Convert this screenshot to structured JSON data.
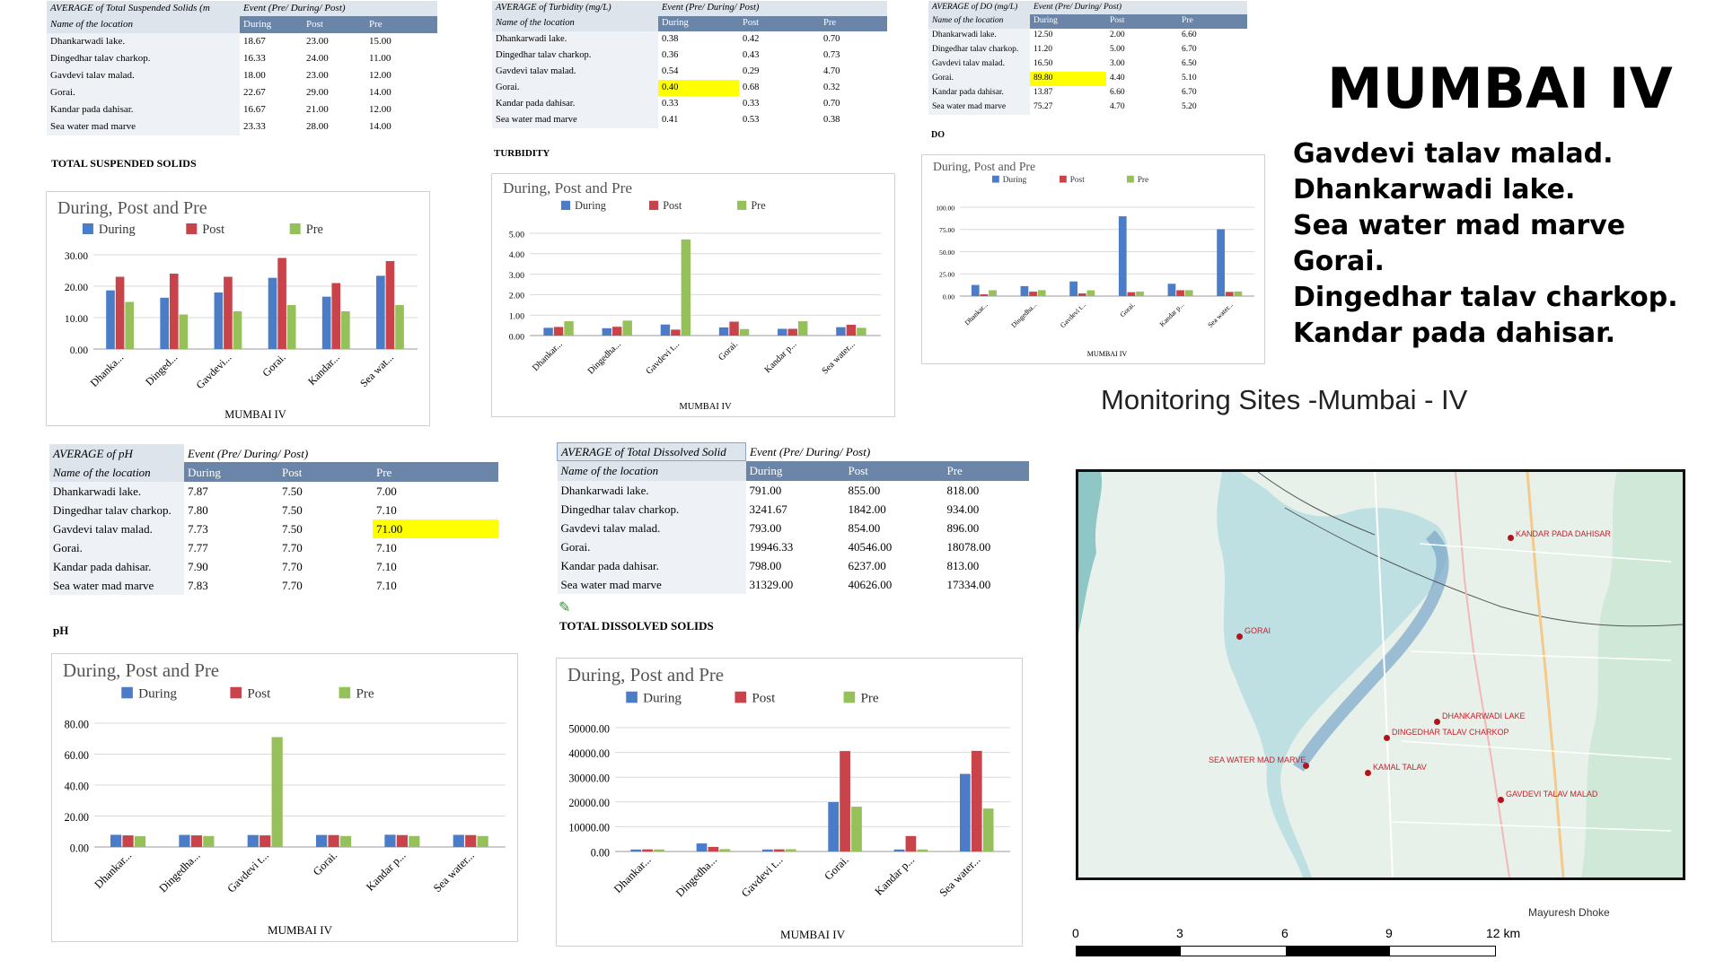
{
  "tables": {
    "tss": {
      "title": "AVERAGE of Total Suspended Solids (m",
      "event": "Event (Pre/ During/ Post)",
      "col_name": "Name of the location",
      "cols": [
        "During",
        "Post",
        "Pre"
      ],
      "rows": [
        {
          "name": "Dhankarwadi lake.",
          "vals": [
            "18.67",
            "23.00",
            "15.00"
          ]
        },
        {
          "name": "Dingedhar talav charkop.",
          "vals": [
            "16.33",
            "24.00",
            "11.00"
          ]
        },
        {
          "name": "Gavdevi talav malad.",
          "vals": [
            "18.00",
            "23.00",
            "12.00"
          ]
        },
        {
          "name": "Gorai.",
          "vals": [
            "22.67",
            "29.00",
            "14.00"
          ]
        },
        {
          "name": "Kandar pada dahisar.",
          "vals": [
            "16.67",
            "21.00",
            "12.00"
          ]
        },
        {
          "name": "Sea water mad marve",
          "vals": [
            "23.33",
            "28.00",
            "14.00"
          ]
        }
      ],
      "section": "TOTAL SUSPENDED SOLIDS"
    },
    "turb": {
      "title": "AVERAGE of Turbidity (mg/L)",
      "event": "Event (Pre/ During/ Post)",
      "col_name": "Name of the location",
      "cols": [
        "During",
        "Post",
        "Pre"
      ],
      "rows": [
        {
          "name": "Dhankarwadi lake.",
          "vals": [
            "0.38",
            "0.42",
            "0.70"
          ]
        },
        {
          "name": "Dingedhar talav charkop.",
          "vals": [
            "0.36",
            "0.43",
            "0.73"
          ]
        },
        {
          "name": "Gavdevi talav malad.",
          "vals": [
            "0.54",
            "0.29",
            "4.70"
          ]
        },
        {
          "name": "Gorai.",
          "vals": [
            "0.40",
            "0.68",
            "0.32"
          ]
        },
        {
          "name": "Kandar pada dahisar.",
          "vals": [
            "0.33",
            "0.33",
            "0.70"
          ]
        },
        {
          "name": "Sea water mad marve",
          "vals": [
            "0.41",
            "0.53",
            "0.38"
          ]
        }
      ],
      "section": "TURBIDITY"
    },
    "do": {
      "title": "AVERAGE of DO (mg/L)",
      "event": "Event (Pre/ During/ Post)",
      "col_name": "Name of the location",
      "cols": [
        "During",
        "Post",
        "Pre"
      ],
      "rows": [
        {
          "name": "Dhankarwadi lake.",
          "vals": [
            "12.50",
            "2.00",
            "6.60"
          ]
        },
        {
          "name": "Dingedhar talav charkop.",
          "vals": [
            "11.20",
            "5.00",
            "6.70"
          ]
        },
        {
          "name": "Gavdevi talav malad.",
          "vals": [
            "16.50",
            "3.00",
            "6.50"
          ]
        },
        {
          "name": "Gorai.",
          "vals": [
            "89.80",
            "4.40",
            "5.10"
          ]
        },
        {
          "name": "Kandar pada dahisar.",
          "vals": [
            "13.87",
            "6.60",
            "6.70"
          ]
        },
        {
          "name": "Sea water mad marve",
          "vals": [
            "75.27",
            "4.70",
            "5.20"
          ]
        }
      ],
      "section": "DO"
    },
    "ph": {
      "title": "AVERAGE of pH",
      "event": "Event (Pre/ During/ Post)",
      "col_name": "Name of the location",
      "cols": [
        "During",
        "Post",
        "Pre"
      ],
      "rows": [
        {
          "name": "Dhankarwadi lake.",
          "vals": [
            "7.87",
            "7.50",
            "7.00"
          ]
        },
        {
          "name": "Dingedhar talav charkop.",
          "vals": [
            "7.80",
            "7.50",
            "7.10"
          ]
        },
        {
          "name": "Gavdevi talav malad.",
          "vals": [
            "7.73",
            "7.50",
            "71.00"
          ]
        },
        {
          "name": "Gorai.",
          "vals": [
            "7.77",
            "7.70",
            "7.10"
          ]
        },
        {
          "name": "Kandar pada dahisar.",
          "vals": [
            "7.90",
            "7.70",
            "7.10"
          ]
        },
        {
          "name": "Sea water mad marve",
          "vals": [
            "7.83",
            "7.70",
            "7.10"
          ]
        }
      ],
      "section": "pH"
    },
    "tds": {
      "title": "AVERAGE of Total Dissolved Solid",
      "event": "Event (Pre/ During/ Post)",
      "col_name": "Name of the location",
      "cols": [
        "During",
        "Post",
        "Pre"
      ],
      "rows": [
        {
          "name": "Dhankarwadi lake.",
          "vals": [
            "791.00",
            "855.00",
            "818.00"
          ]
        },
        {
          "name": "Dingedhar talav charkop.",
          "vals": [
            "3241.67",
            "1842.00",
            "934.00"
          ]
        },
        {
          "name": "Gavdevi talav malad.",
          "vals": [
            "793.00",
            "854.00",
            "896.00"
          ]
        },
        {
          "name": "Gorai.",
          "vals": [
            "19946.33",
            "40546.00",
            "18078.00"
          ]
        },
        {
          "name": "Kandar pada dahisar.",
          "vals": [
            "798.00",
            "6237.00",
            "813.00"
          ]
        },
        {
          "name": "Sea water mad marve",
          "vals": [
            "31329.00",
            "40626.00",
            "17334.00"
          ]
        }
      ],
      "section": "TOTAL DISSOLVED SOLIDS"
    }
  },
  "colors": {
    "header_band": "#6a85a8",
    "highlight": "#ffff00",
    "during": "#4a7cc7",
    "post": "#c9434a",
    "pre": "#96c05a"
  },
  "chart_data": [
    {
      "id": "tss",
      "type": "bar",
      "title": "During, Post and Pre",
      "xlabel": "MUMBAI IV",
      "categories": [
        "Dhanka...",
        "Dinged...",
        "Gavdevi...",
        "Gorai.",
        "Kandar...",
        "Sea wat..."
      ],
      "ylim": [
        0,
        30
      ],
      "yticks": [
        "0.00",
        "10.00",
        "20.00",
        "30.00"
      ],
      "series": [
        {
          "name": "During",
          "values": [
            18.67,
            16.33,
            18.0,
            22.67,
            16.67,
            23.33
          ]
        },
        {
          "name": "Post",
          "values": [
            23.0,
            24.0,
            23.0,
            29.0,
            21.0,
            28.0
          ]
        },
        {
          "name": "Pre",
          "values": [
            15.0,
            11.0,
            12.0,
            14.0,
            12.0,
            14.0
          ]
        }
      ]
    },
    {
      "id": "turb",
      "type": "bar",
      "title": "During, Post and Pre",
      "xlabel": "MUMBAI IV",
      "categories": [
        "Dhankar...",
        "Dingedha...",
        "Gavdevi t...",
        "Gorai.",
        "Kandar p...",
        "Sea water..."
      ],
      "ylim": [
        0,
        5
      ],
      "yticks": [
        "0.00",
        "1.00",
        "2.00",
        "3.00",
        "4.00",
        "5.00"
      ],
      "series": [
        {
          "name": "During",
          "values": [
            0.38,
            0.36,
            0.54,
            0.4,
            0.33,
            0.41
          ]
        },
        {
          "name": "Post",
          "values": [
            0.42,
            0.43,
            0.29,
            0.68,
            0.33,
            0.53
          ]
        },
        {
          "name": "Pre",
          "values": [
            0.7,
            0.73,
            4.7,
            0.32,
            0.7,
            0.38
          ]
        }
      ]
    },
    {
      "id": "do",
      "type": "bar",
      "title": "During, Post and Pre",
      "xlabel": "MUMBAI IV",
      "categories": [
        "Dhankar...",
        "Dingedha...",
        "Gavdevi t...",
        "Gorai.",
        "Kandar p...",
        "Sea water..."
      ],
      "ylim": [
        0,
        100
      ],
      "yticks": [
        "0.00",
        "25.00",
        "50.00",
        "75.00",
        "100.00"
      ],
      "series": [
        {
          "name": "During",
          "values": [
            12.5,
            11.2,
            16.5,
            89.8,
            13.87,
            75.27
          ]
        },
        {
          "name": "Post",
          "values": [
            2.0,
            5.0,
            3.0,
            4.4,
            6.6,
            4.7
          ]
        },
        {
          "name": "Pre",
          "values": [
            6.6,
            6.7,
            6.5,
            5.1,
            6.7,
            5.2
          ]
        }
      ]
    },
    {
      "id": "ph",
      "type": "bar",
      "title": "During, Post and Pre",
      "xlabel": "MUMBAI IV",
      "categories": [
        "Dhankar...",
        "Dingedha...",
        "Gavdevi t...",
        "Gorai.",
        "Kandar p...",
        "Sea water..."
      ],
      "ylim": [
        0,
        80
      ],
      "yticks": [
        "0.00",
        "20.00",
        "40.00",
        "60.00",
        "80.00"
      ],
      "series": [
        {
          "name": "During",
          "values": [
            7.87,
            7.8,
            7.73,
            7.77,
            7.9,
            7.83
          ]
        },
        {
          "name": "Post",
          "values": [
            7.5,
            7.5,
            7.5,
            7.7,
            7.7,
            7.7
          ]
        },
        {
          "name": "Pre",
          "values": [
            7.0,
            7.1,
            71.0,
            7.1,
            7.1,
            7.1
          ]
        }
      ]
    },
    {
      "id": "tds",
      "type": "bar",
      "title": "During, Post and Pre",
      "xlabel": "MUMBAI IV",
      "categories": [
        "Dhankar...",
        "Dingedha...",
        "Gavdevi t...",
        "Gorai.",
        "Kandar p...",
        "Sea water..."
      ],
      "ylim": [
        0,
        50000
      ],
      "yticks": [
        "0.00",
        "10000.00",
        "20000.00",
        "30000.00",
        "40000.00",
        "50000.00"
      ],
      "series": [
        {
          "name": "During",
          "values": [
            791,
            3241.67,
            793,
            19946.33,
            798,
            31329
          ]
        },
        {
          "name": "Post",
          "values": [
            855,
            1842,
            854,
            40546,
            6237,
            40626
          ]
        },
        {
          "name": "Pre",
          "values": [
            818,
            934,
            896,
            18078,
            813,
            17334
          ]
        }
      ]
    }
  ],
  "heading": "MUMBAI IV",
  "sites": [
    "Gavdevi talav malad.",
    "Dhankarwadi lake.",
    "Sea water mad marve",
    "Gorai.",
    "Dingedhar talav charkop.",
    "Kandar pada dahisar."
  ],
  "monitoring_caption": "Monitoring Sites -Mumbai - IV",
  "map": {
    "labels": {
      "kandar": "KANDAR PADA DAHISAR",
      "gorai": "GORAI",
      "dhankarwadi": "DHANKARWADI LAKE",
      "dingedhar": "DINGEDHAR TALAV CHARKOP",
      "seawater": "SEA WATER MAD MARVE",
      "kamal": "KAMAL TALAV",
      "gavdevi": "GAVDEVI TALAV MALAD"
    },
    "credit": "Mayuresh Dhoke",
    "scale": [
      "0",
      "3",
      "6",
      "9",
      "12 km"
    ]
  }
}
